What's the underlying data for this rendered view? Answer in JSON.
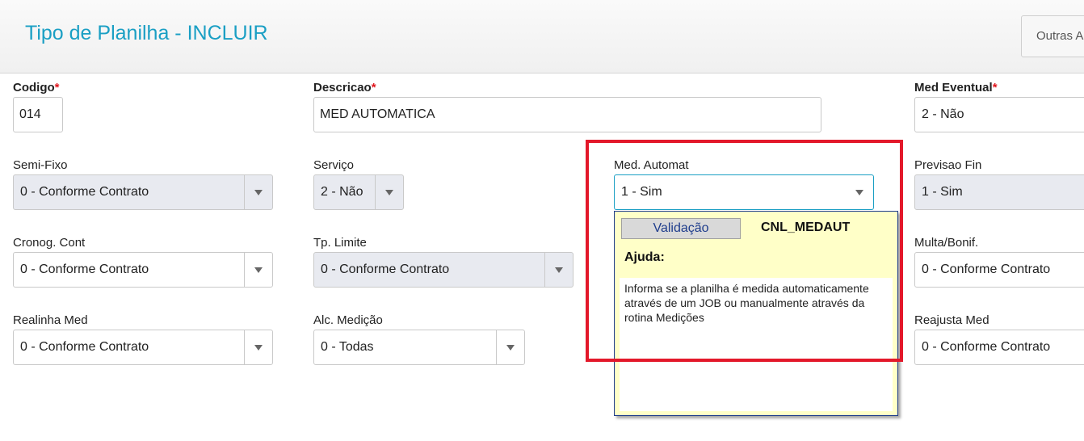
{
  "header": {
    "title": "Tipo de Planilha - INCLUIR",
    "other_actions": "Outras Ações"
  },
  "required_mark": "*",
  "fields": {
    "codigo": {
      "label": "Codigo",
      "value": "014"
    },
    "descricao": {
      "label": "Descricao",
      "value": "MED AUTOMATICA"
    },
    "med_eventual": {
      "label": "Med Eventual",
      "value": "2 - Não"
    },
    "semi_fixo": {
      "label": "Semi-Fixo",
      "value": "0 - Conforme Contrato"
    },
    "servico": {
      "label": "Serviço",
      "value": "2 - Não"
    },
    "med_automat": {
      "label": "Med. Automat",
      "value": "1 - Sim"
    },
    "previsao_fin": {
      "label": "Previsao Fin",
      "value": "1 - Sim"
    },
    "cronog_cont": {
      "label": "Cronog. Cont",
      "value": "0 - Conforme Contrato"
    },
    "tp_limite": {
      "label": "Tp. Limite",
      "value": "0 - Conforme Contrato"
    },
    "multa_bonif": {
      "label": "Multa/Bonif.",
      "value": "0 - Conforme Contrato"
    },
    "realinha_med": {
      "label": "Realinha Med",
      "value": "0 - Conforme Contrato"
    },
    "alc_medicao": {
      "label": "Alc. Medição",
      "value": "0 - Todas"
    },
    "reajusta_med": {
      "label": "Reajusta Med",
      "value": "0 - Conforme Contrato"
    }
  },
  "help_popup": {
    "tab_label": "Validação",
    "field_code": "CNL_MEDAUT",
    "title": "Ajuda:",
    "text": "Informa se a planilha é medida automaticamente através de um JOB ou manualmente através da rotina Medições"
  },
  "colors": {
    "title": "#1a9fc4",
    "required": "#e0161e",
    "highlight": "#e3182a",
    "help_background": "#ffffc8"
  }
}
